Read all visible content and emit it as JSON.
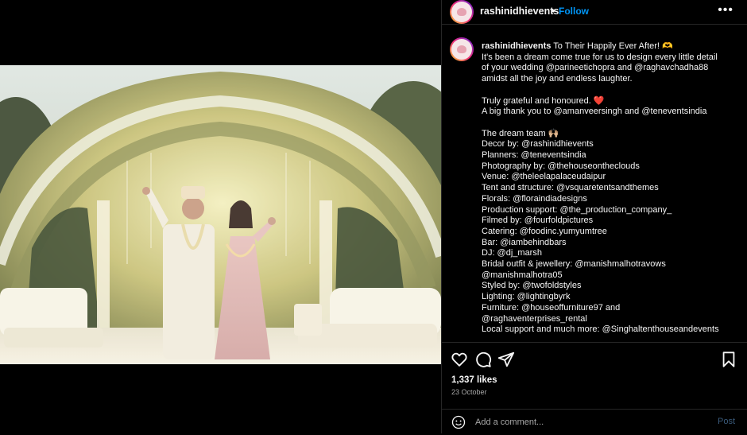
{
  "post": {
    "username": "rashinidhievents",
    "dot": "•",
    "follow_label": "Follow",
    "more_label": "•••"
  },
  "caption": {
    "username": "rashinidhievents",
    "first_line": "To Their Happily Ever After! 🫶",
    "lines": [
      "It's been a dream come true for us to design every little detail",
      "of your wedding @parineetichopra and @raghavchadha88",
      "amidst all the joy and endless laughter.",
      "",
      "Truly grateful and honoured. ❤️",
      "A big thank you to @amanveersingh and @teneventsindia",
      "",
      "The dream team 🙌🏼",
      "Decor by: @rashinidhievents",
      "Planners: @teneventsindia",
      "Photography by: @thehouseontheclouds",
      "Venue: @theleelapalaceudaipur",
      "Tent and structure: @vsquaretentsandthemes",
      "Florals: @floraindiadesigns",
      "Production support: @the_production_company_",
      "Filmed by: @fourfoldpictures",
      "Catering: @foodinc.yumyumtree",
      "Bar: @iambehindbars",
      "DJ: @dj_marsh",
      "Bridal outfit & jewellery: @manishmalhotravows",
      "@manishmalhotra05",
      "Styled by: @twofoldstyles",
      "Lighting: @lightingbyrk",
      "Furniture: @houseoffurniture97 and",
      "@raghaventerprises_rental",
      "Local support and much more: @Singhaltenthouseandevents"
    ]
  },
  "stats": {
    "likes": "1,337 likes",
    "date": "23 October"
  },
  "comment": {
    "placeholder": "Add a comment...",
    "post_label": "Post"
  },
  "icons": {
    "like": "heart-icon",
    "comment": "comment-icon",
    "share": "paper-plane-icon",
    "save": "bookmark-icon",
    "emoji": "smiley-icon"
  }
}
